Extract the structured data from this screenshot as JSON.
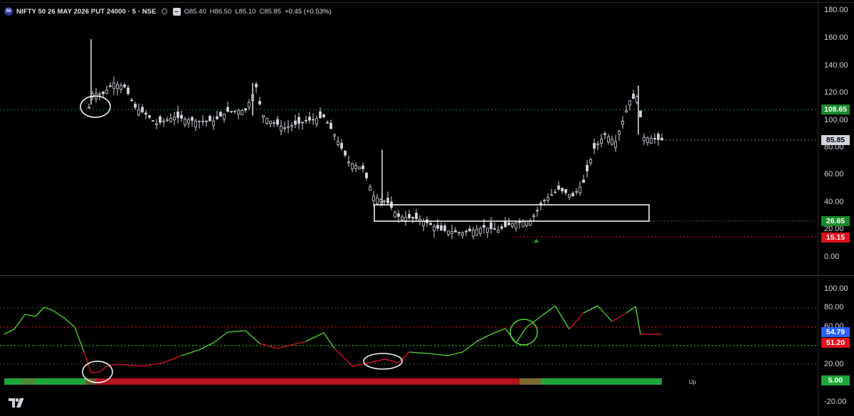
{
  "legend": {
    "badge_text": "50",
    "title": "NIFTY 50 26 MAY 2026 PUT 24000 · 5 · NSE",
    "open": "O85.40",
    "high": "H86.50",
    "low": "L85.10",
    "close": "C85.85",
    "change": "+0.45 (+0.53%)"
  },
  "price_axis": {
    "labels": [
      "180.00",
      "160.00",
      "140.00",
      "120.00",
      "100.00",
      "80.00",
      "60.00",
      "40.00",
      "20.00",
      "0.00"
    ],
    "tags": [
      {
        "text": "108.65",
        "bg": "#1b8a2e",
        "fg": "#ffffff"
      },
      {
        "text": "85.85",
        "bg": "#d1d4dc",
        "fg": "#000000"
      },
      {
        "text": "26.65",
        "bg": "#1b8a2e",
        "fg": "#ffffff"
      },
      {
        "text": "15.15",
        "bg": "#e0121e",
        "fg": "#ffffff"
      }
    ]
  },
  "rsi_axis": {
    "labels": [
      "100.00",
      "80.00",
      "60.00",
      "40.00",
      "20.00",
      "0.00",
      "-20.00"
    ],
    "tags": [
      {
        "text": "54.79",
        "bg": "#2962ff",
        "fg": "#ffffff"
      },
      {
        "text": "51.20",
        "bg": "#e0121e",
        "fg": "#ffffff"
      },
      {
        "text": "5.00",
        "bg": "#1ea53b",
        "fg": "#ffffff"
      }
    ]
  },
  "trend_label": "Up",
  "colors": {
    "background": "#000000",
    "candle": "#d1d4dc",
    "rsi_up": "#4cdc2c",
    "rsi_down": "#e0121e",
    "annotation": "#ffffff"
  },
  "icons": {
    "logo": "tradingview-logo-icon"
  }
}
